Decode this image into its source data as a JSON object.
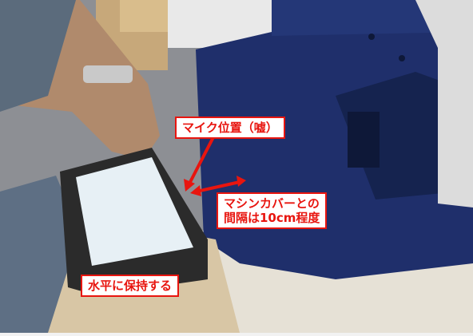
{
  "annotations": {
    "mic_position": "マイク位置（嘘）",
    "machine_cover_gap": [
      "マシンカバーとの",
      "間隔は10cm程度"
    ],
    "hold_level": "水平に保持する"
  },
  "colors": {
    "annotation_red": "#e8150f",
    "printer_navy": "#1f2f6b",
    "tablet_body": "#2b2b2b",
    "tablet_screen": "#e7f0f5"
  }
}
